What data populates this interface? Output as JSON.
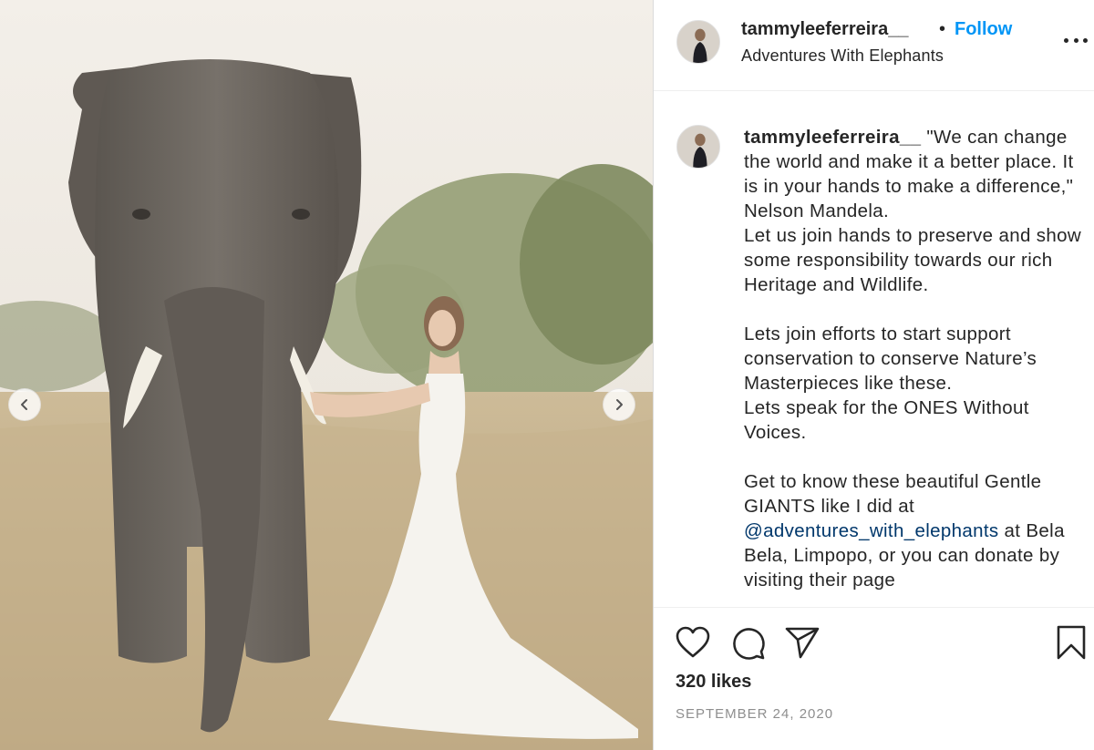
{
  "post": {
    "username": "tammyleeferreira__",
    "follow_label": "Follow",
    "separator": "•",
    "location": "Adventures With Elephants"
  },
  "caption": {
    "username": "tammyleeferreira__",
    "intro": " \"We can change the world and make it a better place. It is in your hands to make a difference,\" Nelson Mandela.",
    "line2": "Let us join hands to preserve and show some responsibility towards our rich Heritage and Wildlife.",
    "para2": "Lets join efforts to start support conservation to conserve Nature’s Masterpieces like these.",
    "para2b": "Lets speak for the ONES Without Voices.",
    "para3_before": "Get to know these beautiful Gentle GIANTS like I did at ",
    "mention": "@adventures_with_elephants",
    "para3_after": " at Bela Bela, Limpopo, or you can donate by visiting their page"
  },
  "footer": {
    "likes": "320 likes",
    "date": "SEPTEMBER 24, 2020"
  },
  "icons": {
    "like": "heart-icon",
    "comment": "speech-bubble-icon",
    "share": "paper-plane-icon",
    "save": "bookmark-icon",
    "more": "ellipsis-icon",
    "prev": "chevron-left-icon",
    "next": "chevron-right-icon"
  },
  "colors": {
    "follow": "#0095f6",
    "mention": "#00376b",
    "muted": "#8e8e8e",
    "text": "#262626"
  }
}
